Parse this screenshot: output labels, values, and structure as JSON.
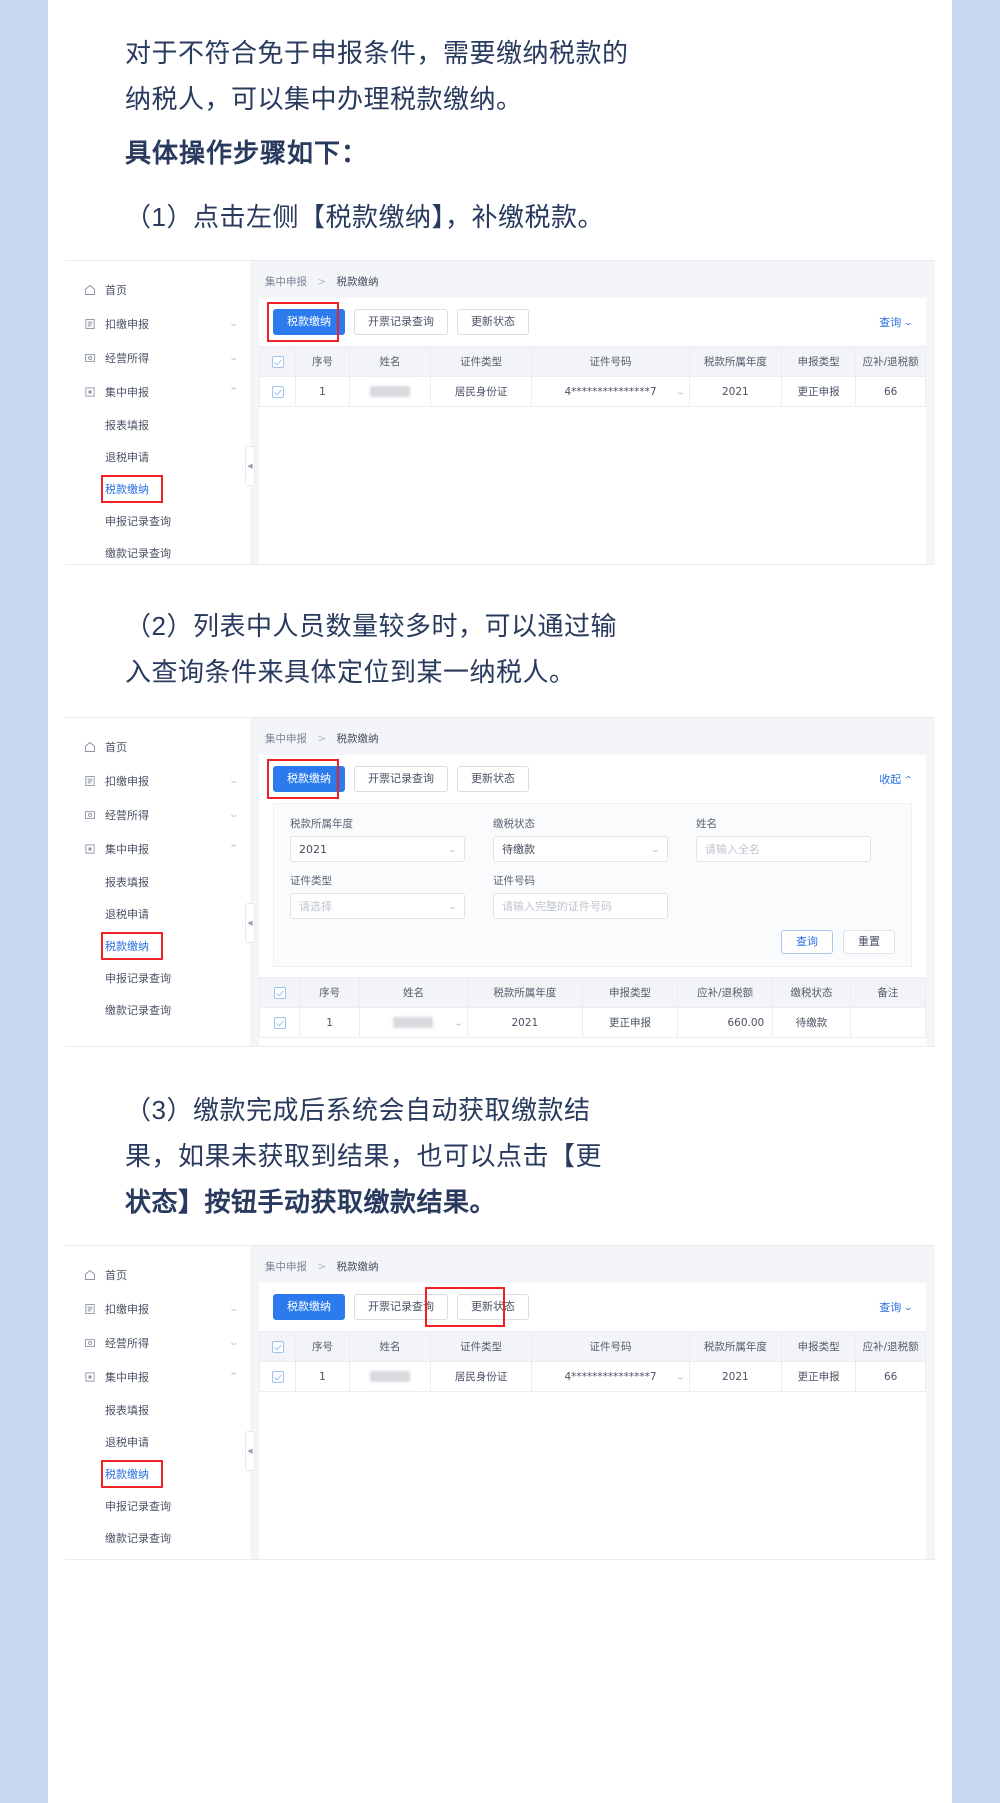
{
  "doc": {
    "intro_line1": "对于不符合免于申报条件，需要缴纳税款的",
    "intro_line2": "纳税人，可以集中办理税款缴纳。",
    "bold_heading": "具体操作步骤如下：",
    "step1": "（1）点击左侧【税款缴纳】，补缴税款。",
    "step2_line1": "（2）列表中人员数量较多时，可以通过输",
    "step2_line2": "入查询条件来具体定位到某一纳税人。",
    "step3_line1": "（3）缴款完成后系统会自动获取缴款结",
    "step3_line2": "果，如果未获取到结果，也可以点击【更",
    "step3_line3": "状态】按钮手动获取缴款结果。"
  },
  "colors": {
    "text": "#283a5e",
    "primary": "#2b7bee",
    "link": "#2b6fe0",
    "highlight_box": "#ee2222",
    "gutter": "#c9d6f2"
  },
  "sidebar": {
    "items": [
      {
        "label": "首页",
        "icon": "home-icon",
        "expandable": false
      },
      {
        "label": "扣缴申报",
        "icon": "form-icon",
        "expandable": true,
        "chevron": "down"
      },
      {
        "label": "经营所得",
        "icon": "money-icon",
        "expandable": true,
        "chevron": "down"
      },
      {
        "label": "集中申报",
        "icon": "grid-icon",
        "expandable": true,
        "chevron": "up"
      }
    ],
    "sub_items": [
      {
        "label": "报表填报",
        "active": false
      },
      {
        "label": "退税申请",
        "active": false
      },
      {
        "label": "税款缴纳",
        "active": true,
        "highlighted": true
      },
      {
        "label": "申报记录查询",
        "active": false
      },
      {
        "label": "缴款记录查询",
        "active": false
      }
    ]
  },
  "breadcrumb": {
    "root": "集中申报",
    "separator": ">",
    "current": "税款缴纳"
  },
  "toolbar": {
    "pay_button": "税款缴纳",
    "invoice_query_button": "开票记录查询",
    "update_status_button": "更新状态",
    "query_link": "查询",
    "collapse_link": "收起",
    "chevron_down": "⌄",
    "chevron_up": "⌃"
  },
  "filters": {
    "tax_year": {
      "label": "税款所属年度",
      "value": "2021"
    },
    "pay_status": {
      "label": "缴税状态",
      "value": "待缴款"
    },
    "name": {
      "label": "姓名",
      "placeholder": "请输入全名",
      "value": ""
    },
    "id_type": {
      "label": "证件类型",
      "placeholder": "请选择",
      "value": ""
    },
    "id_number": {
      "label": "证件号码",
      "placeholder": "请输入完整的证件号码",
      "value": ""
    },
    "query_button": "查询",
    "reset_button": "重置"
  },
  "table_wide": {
    "columns": [
      "序号",
      "姓名",
      "证件类型",
      "证件号码",
      "税款所属年度",
      "申报类型",
      "应补/退税额"
    ],
    "rows": [
      {
        "index": "1",
        "name": "",
        "id_type": "居民身份证",
        "id_number": "4***************7",
        "tax_year": "2021",
        "declare_type": "更正申报",
        "amount": "66"
      }
    ]
  },
  "table_narrow": {
    "columns": [
      "序号",
      "姓名",
      "税款所属年度",
      "申报类型",
      "应补/退税额",
      "缴税状态",
      "备注"
    ],
    "rows": [
      {
        "index": "1",
        "name": "",
        "tax_year": "2021",
        "declare_type": "更正申报",
        "amount": "660.00",
        "pay_status": "待缴款",
        "remark": ""
      }
    ]
  }
}
